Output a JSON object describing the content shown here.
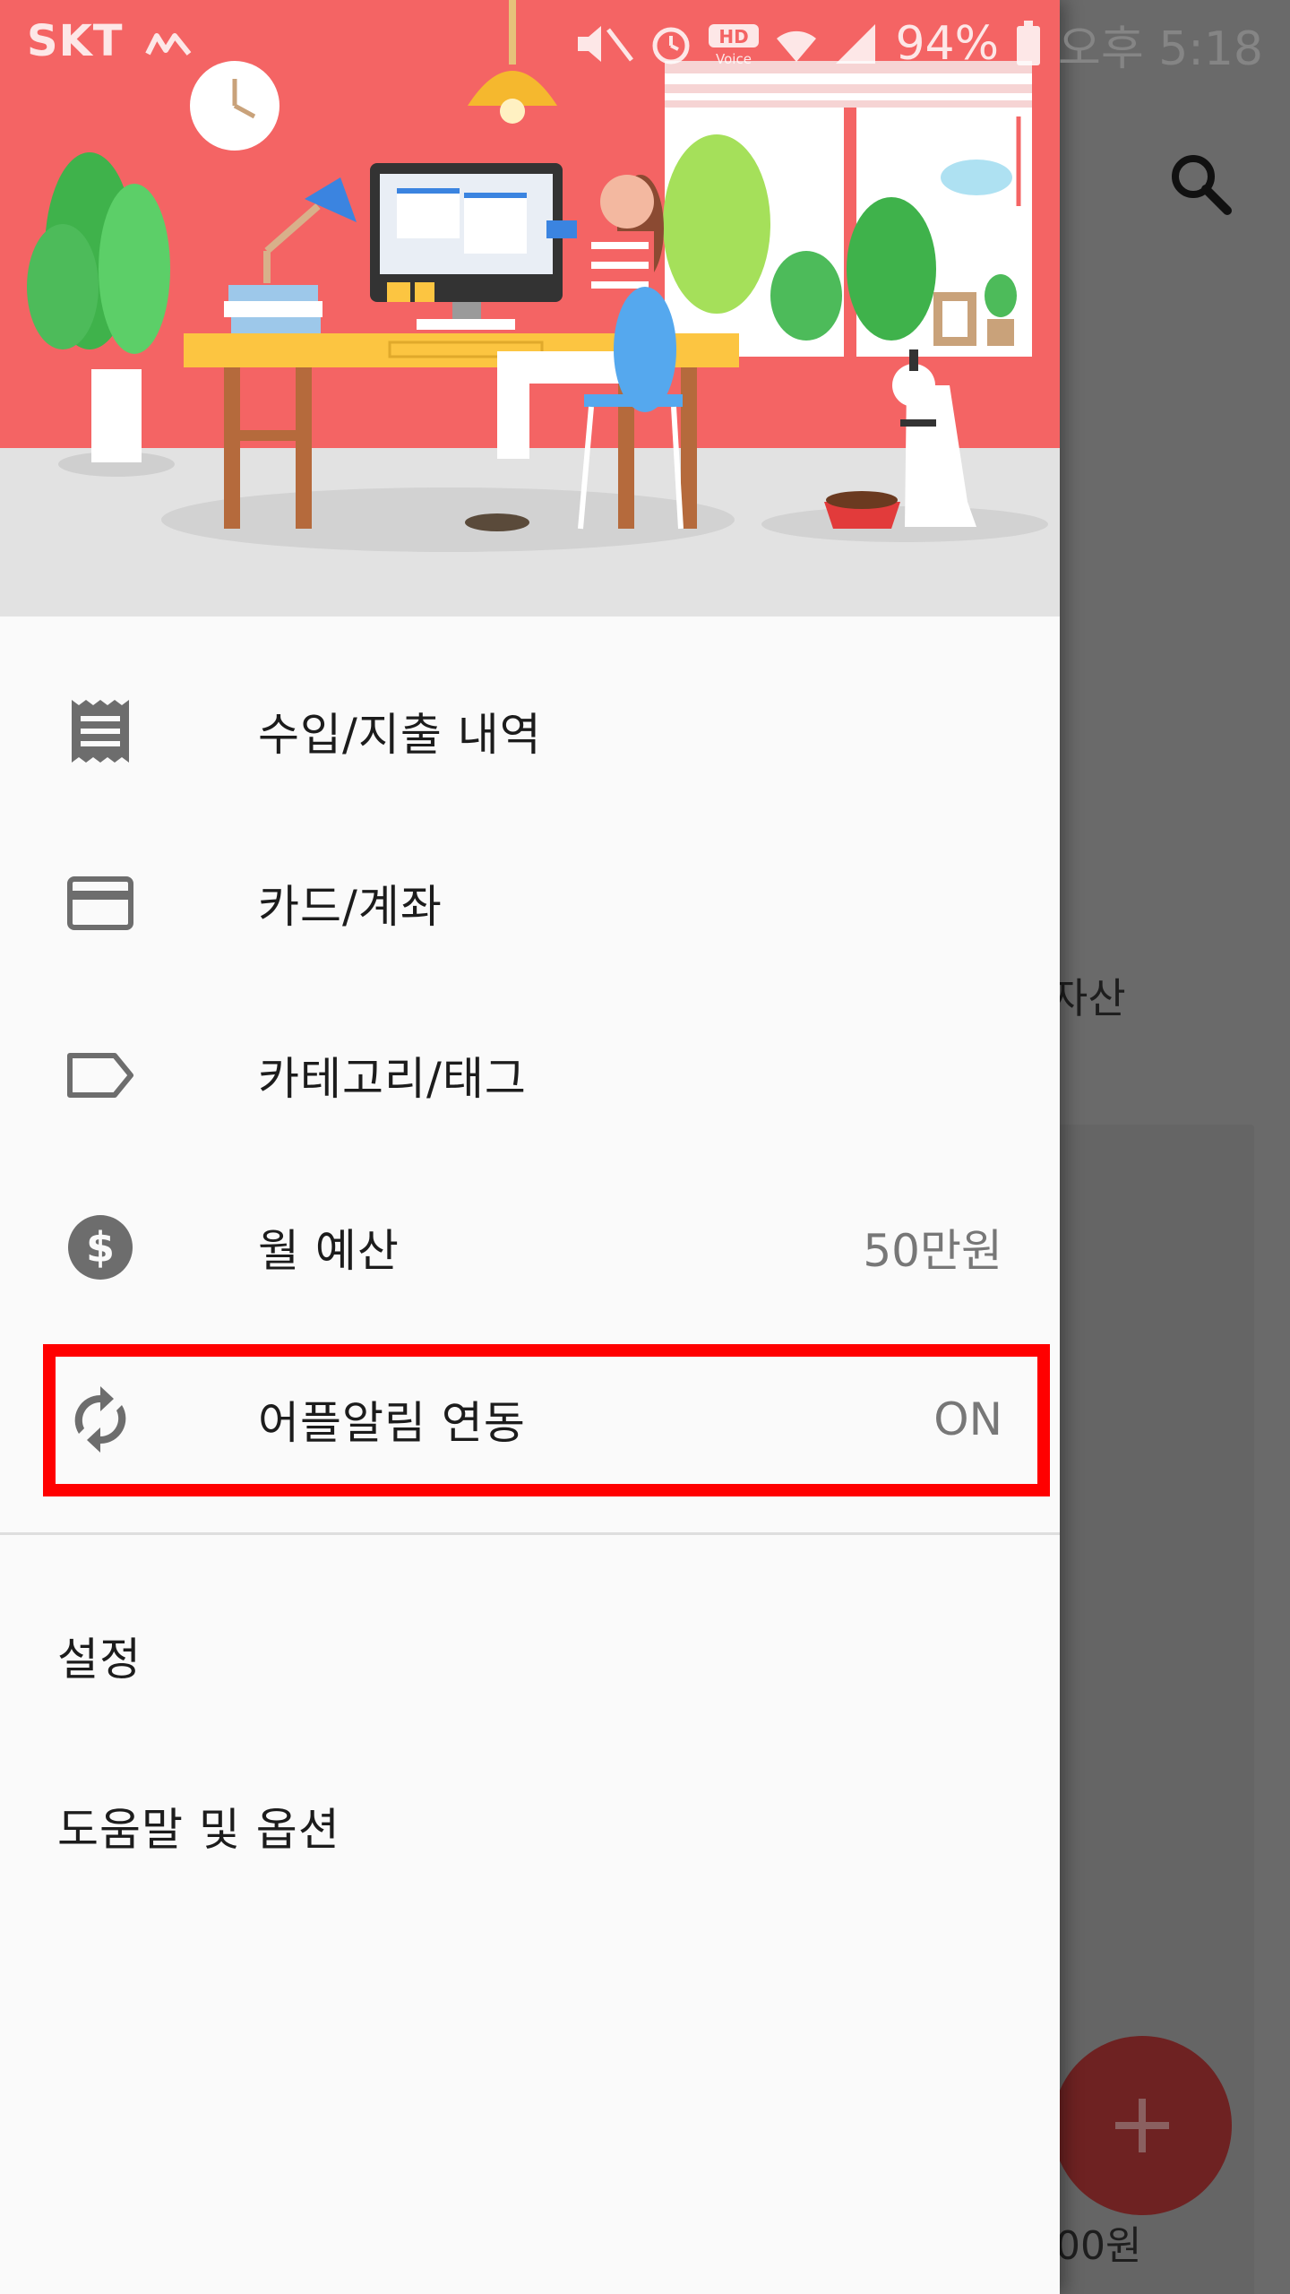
{
  "status_bar": {
    "carrier": "SKT",
    "battery": "94%",
    "time": "오후 5:18"
  },
  "background": {
    "asset_label": "자산",
    "amount_text": "00원",
    "fab_icon": "plus-icon",
    "search_icon": "search-icon"
  },
  "drawer": {
    "items": [
      {
        "label": "수입/지출 내역",
        "icon": "receipt-icon"
      },
      {
        "label": "카드/계좌",
        "icon": "credit-card-icon"
      },
      {
        "label": "카테고리/태그",
        "icon": "tag-icon"
      },
      {
        "label": "월 예산",
        "value": "50만원",
        "icon": "dollar-circle-icon"
      },
      {
        "label": "어플알림 연동",
        "value": "ON",
        "icon": "sync-icon"
      }
    ],
    "secondary": [
      {
        "label": "설정"
      },
      {
        "label": "도움말 및 옵션"
      }
    ]
  },
  "colors": {
    "header_bg": "#f46464",
    "highlight": "#ff0000",
    "icon": "#6d6d6d"
  }
}
